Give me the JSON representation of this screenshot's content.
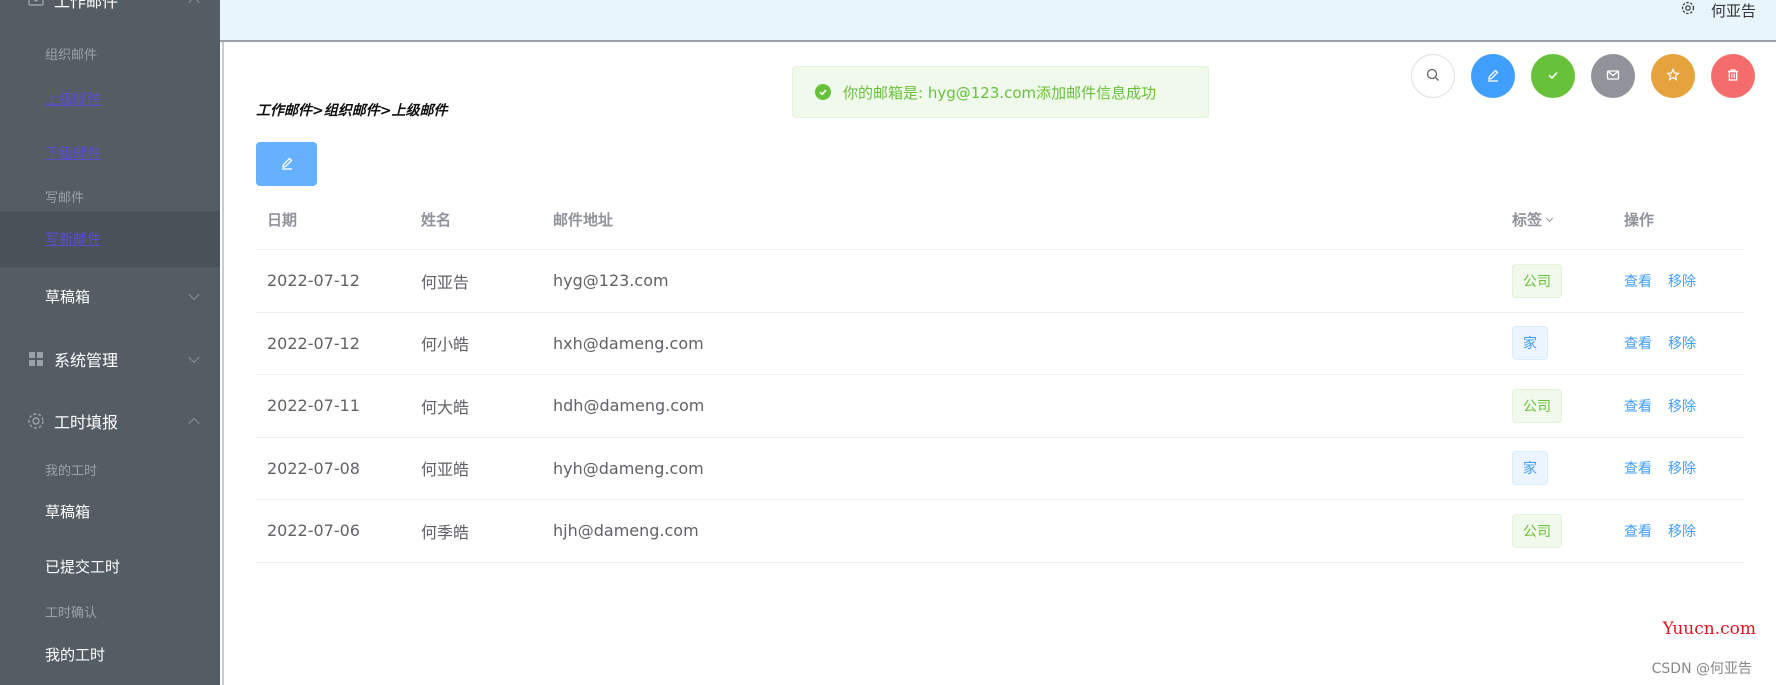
{
  "sidebar": {
    "group_mail": "工作邮件",
    "sub_org": "组织邮件",
    "sub_upper": "上级邮件",
    "sub_lower": "下级邮件",
    "sub_write": "写邮件",
    "sub_write_new": "写新邮件",
    "drafts": "草稿箱",
    "group_system": "系统管理",
    "group_worktime": "工时填报",
    "wt_mine": "我的工时",
    "wt_drafts": "草稿箱",
    "wt_submitted": "已提交工时",
    "wt_confirm": "工时确认",
    "wt_mine2": "我的工时"
  },
  "header": {
    "user": "何亚告"
  },
  "breadcrumb": "工作邮件>组织邮件>上级邮件",
  "toast": {
    "message": "你的邮箱是: hyg@123.com添加邮件信息成功"
  },
  "table": {
    "headers": {
      "date": "日期",
      "name": "姓名",
      "email": "邮件地址",
      "tag": "标签",
      "op": "操作"
    },
    "rows": [
      {
        "date": "2022-07-12",
        "name": "何亚告",
        "email": "hyg@123.com",
        "tag": "公司",
        "tag_type": "green"
      },
      {
        "date": "2022-07-12",
        "name": "何小皓",
        "email": "hxh@dameng.com",
        "tag": "家",
        "tag_type": "blue"
      },
      {
        "date": "2022-07-11",
        "name": "何大皓",
        "email": "hdh@dameng.com",
        "tag": "公司",
        "tag_type": "green"
      },
      {
        "date": "2022-07-08",
        "name": "何亚皓",
        "email": "hyh@dameng.com",
        "tag": "家",
        "tag_type": "blue"
      },
      {
        "date": "2022-07-06",
        "name": "何季皓",
        "email": "hjh@dameng.com",
        "tag": "公司",
        "tag_type": "green"
      }
    ],
    "op_view": "查看",
    "op_remove": "移除"
  },
  "action_buttons": [
    {
      "icon": "search-icon",
      "color": "#ffffff"
    },
    {
      "icon": "edit-icon",
      "color": "#409eff"
    },
    {
      "icon": "check-icon",
      "color": "#67c23a"
    },
    {
      "icon": "message-icon",
      "color": "#909399"
    },
    {
      "icon": "star-icon",
      "color": "#e6a23c"
    },
    {
      "icon": "delete-icon",
      "color": "#f56c6c"
    }
  ],
  "watermarks": {
    "site": "Yuucn.com",
    "csdn": "CSDN @何亚告"
  }
}
